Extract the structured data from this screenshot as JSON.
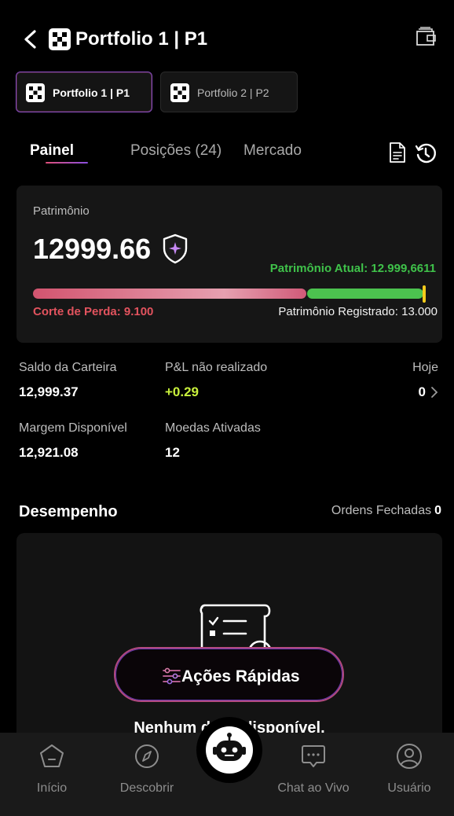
{
  "header": {
    "title": "Portfolio 1 | P1",
    "back_icon": "chevron-left-icon",
    "logo_icon": "portfolio-logo-icon",
    "wallet_icon": "wallet-icon"
  },
  "portfolio_tabs": [
    {
      "label": "Portfolio 1 | P1",
      "active": true
    },
    {
      "label": "Portfolio 2 | P2",
      "active": false
    }
  ],
  "tabs": [
    {
      "label": "Painel",
      "active": true
    },
    {
      "label": "Posições (24)",
      "active": false
    },
    {
      "label": "Mercado",
      "active": false
    }
  ],
  "equity": {
    "label": "Patrimônio",
    "value": "12999.66",
    "current_label": "Patrimônio Atual: 12.999,6611",
    "cut_loss_label": "Corte de Perda: 9.100",
    "registered_label": "Patrimônio Registrado: 13.000",
    "cut_loss": 9100,
    "current": 12999.6611,
    "registered": 13000
  },
  "stats": {
    "wallet_balance": {
      "label": "Saldo da Carteira",
      "value": "12,999.37"
    },
    "unrealized_pnl": {
      "label": "P&L não realizado",
      "value": "+0.29"
    },
    "today": {
      "label": "Hoje",
      "value": "0"
    },
    "available_margin": {
      "label": "Margem Disponível",
      "value": "12,921.08"
    },
    "active_coins": {
      "label": "Moedas Ativadas",
      "value": "12"
    }
  },
  "performance": {
    "title": "Desempenho",
    "closed_orders_label": "Ordens Fechadas",
    "closed_orders_value": "0",
    "empty_text": "Nenhum dado disponível."
  },
  "quick_actions": {
    "label": "Ações Rápidas"
  },
  "bottom_nav": [
    {
      "label": "Início",
      "icon": "home-icon"
    },
    {
      "label": "Descobrir",
      "icon": "compass-icon"
    },
    {
      "label": "Chat ao Vivo",
      "icon": "chat-icon"
    },
    {
      "label": "Usuário",
      "icon": "user-icon"
    }
  ],
  "colors": {
    "accent_purple": "#8b4fc4",
    "accent_pink": "#e0507a",
    "positive_green": "#3fc24a",
    "pnl_lime": "#c8f03c",
    "loss_red": "#e2535e",
    "marker_yellow": "#f3cb1c"
  }
}
